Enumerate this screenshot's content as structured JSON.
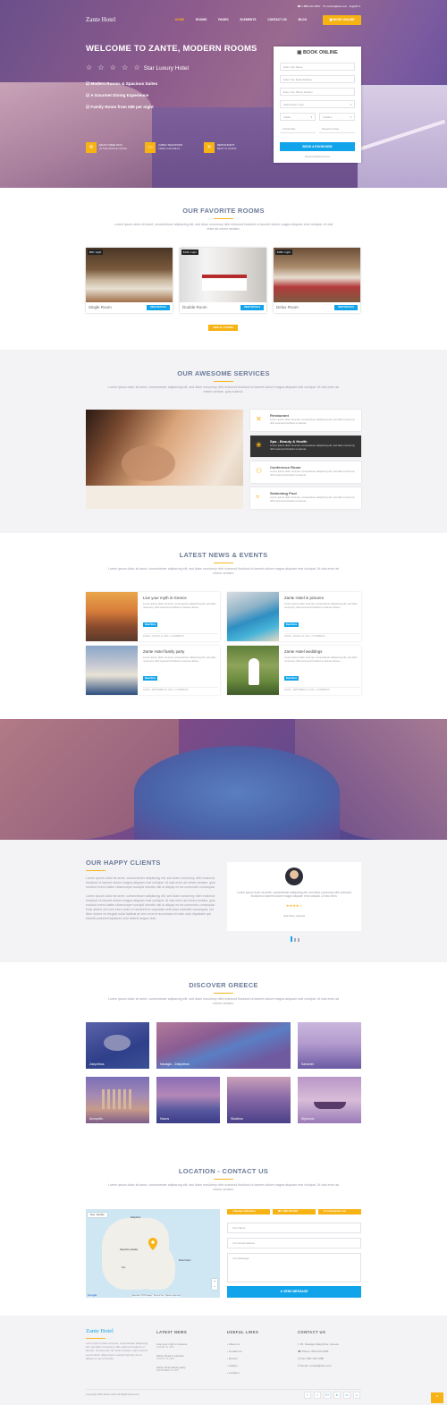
{
  "header": {
    "logo": "Zante Hotel",
    "phone": "1-888-123-4567",
    "email": "contact@site.com",
    "language": "English",
    "menu": [
      "HOME",
      "ROOMS",
      "PAGES",
      "ELEMENTS",
      "CONTACT US",
      "BLOG"
    ],
    "book_button": "BOOK ONLINE"
  },
  "hero": {
    "title": "WELCOME TO ZANTE, MODERN ROOMS",
    "stars": "☆ ☆ ☆ ☆ ☆",
    "rating_label": "Star Luxury Hotel",
    "features": [
      "Modern Rooms & Spacious Suites",
      "A Gourmet Dining Experience",
      "Family Room from €89 per night"
    ],
    "amenities": [
      {
        "icon": "wifi-icon",
        "glyph": "≋",
        "title": "ENJOY FREE WI-FI",
        "sub": "IN THE WHOLE HOTEL"
      },
      {
        "icon": "tv-icon",
        "glyph": "▭",
        "title": "CABLE TELEVISION",
        "sub": "FREE CHANNELS"
      },
      {
        "icon": "restaurant-icon",
        "glyph": "✕",
        "title": "RESTAURANT",
        "sub": "BEST IN ZANTE"
      }
    ]
  },
  "booking": {
    "title": "BOOK ONLINE",
    "name_placeholder": "Enter Your Name",
    "email_placeholder": "Enter Your Email Address",
    "phone_placeholder": "Enter Your Phone Number",
    "room_type": "Select Room Type",
    "adults": "Adults",
    "children": "Children",
    "arrival": "Arrival Date",
    "departure": "Departure Date",
    "submit": "BOOK A ROOM NOW",
    "advanced": "Advanced Booking Form"
  },
  "rooms": {
    "title": "OUR FAVORITE ROOMS",
    "lead": "Lorem ipsum dolor sit amet, consectetuer adipiscing elit, sed diam nonummy nibh euismod tincidunt ut laoreet dolore magna aliquam erat volutpat. Ut wisi enim ad minim veniam.",
    "items": [
      {
        "name": "Single Room",
        "price": "€89 / night",
        "button": "VIEW DETAILS"
      },
      {
        "name": "Double Room",
        "price": "€129 / night",
        "button": "VIEW DETAILS"
      },
      {
        "name": "Delux Room",
        "price": "€189 / night",
        "button": "VIEW DETAILS"
      }
    ],
    "view_all": "VIEW ALL ROOMS"
  },
  "services": {
    "title": "OUR AWESOME SERVICES",
    "lead": "Lorem ipsum dolor sit amet, consectetuer adipiscing elit, sed diam nonummy nibh euismod tincidunt ut laoreet dolore magna aliquam erat volutpat. Ut wisi enim ad minim veniam, quis nostrud.",
    "items": [
      {
        "title": "Restaurant",
        "desc": "Lorem ipsum dolor sit amet, consectetuer adipiscing elit, sed diam nonummy nibh euismod tincidunt ut laoreet.",
        "icon": "restaurant-icon"
      },
      {
        "title": "Spa - Beauty & Health",
        "desc": "Lorem ipsum dolor sit amet, consectetuer adipiscing elit, sed diam nonummy nibh euismod tincidunt ut laoreet.",
        "icon": "spa-icon"
      },
      {
        "title": "Conference Room",
        "desc": "Lorem ipsum dolor sit amet, consectetuer adipiscing elit, sed diam nonummy nibh euismod tincidunt ut laoreet.",
        "icon": "conference-icon"
      },
      {
        "title": "Swimming Pool",
        "desc": "Lorem ipsum dolor sit amet, consectetuer adipiscing elit, sed diam nonummy nibh euismod tincidunt ut laoreet.",
        "icon": "pool-icon"
      }
    ]
  },
  "news": {
    "title": "LATEST NEWS & EVENTS",
    "lead": "Lorem ipsum dolor sit amet, consectetuer adipiscing elit, sed diam nonummy nibh euismod tincidunt ut laoreet dolore magna aliquam erat volutpat. Ut wisi enim ad minim veniam.",
    "items": [
      {
        "title": "Live your myth in Greece",
        "desc": "Lorem ipsum dolor sit amet, consectetuer adipiscing elit, sed diam nonummy nibh euismod tincidunt ut laoreet dolore...",
        "button": "Read More",
        "author": "ZANTE",
        "date": "AUGUST 11, 2015",
        "comments": "0 COMMENTS"
      },
      {
        "title": "Zante Hotel in pictures",
        "desc": "Lorem ipsum dolor sit amet, consectetuer adipiscing elit, sed diam nonummy nibh euismod tincidunt ut laoreet dolore...",
        "button": "Read More",
        "author": "ZANTE",
        "date": "AUGUST 11, 2015",
        "comments": "0 COMMENTS"
      },
      {
        "title": "Zante Hotel family party",
        "desc": "Lorem ipsum dolor sit amet, consectetuer adipiscing elit, sed diam nonummy nibh euismod tincidunt ut laoreet dolore...",
        "button": "Read More",
        "author": "ZANTE",
        "date": "SEPTEMBER 15, 2015",
        "comments": "0 COMMENTS"
      },
      {
        "title": "Zante Hotel weddings",
        "desc": "Lorem ipsum dolor sit amet, consectetuer adipiscing elit, sed diam nonummy nibh euismod tincidunt ut laoreet dolore...",
        "button": "Read More",
        "author": "ZANTE",
        "date": "SEPTEMBER 15, 2015",
        "comments": "0 COMMENTS"
      }
    ]
  },
  "clients": {
    "title": "OUR HAPPY CLIENTS",
    "p1": "Lorem ipsum dolor sit amet, consectetuer adipiscing elit, sed diam nonummy nibh euismod tincidunt ut laoreet dolore magna aliquam erat volutpat. Ut wisi enim ad minim veniam, quis nostrud exerci tation ullamcorper suscipit lobortis nisl ut aliquip ex ea commodo consequat.",
    "p2": "Lorem ipsum dolor sit amet, consectetuer adipiscing elit, sed diam nonummy nibh euismod tincidunt ut laoreet dolore magna aliquam erat volutpat. Ut wisi enim ad minim veniam, quis nostrud exerci tation ullamcorper suscipit lobortis nisl ut aliquip ex ea commodo consequat. Duis autem vel eum iriure dolor in hendrerit in vulputate velit esse molestie consequat, vel illum dolore eu feugiat nulla facilisis at vero eros et accumsan et iusto odio dignissim qui blandit praesent luptatum zzril delenit augue duis.",
    "quote": "Lorem ipsum dolor sit amet, consectetuer adipiscing elit, sed diam nonummy nibh euismod tincidunt ut laoreet dolore magna aliquam erat volutpat. Ut wisi enim.",
    "stars": "★★★★☆",
    "author": "John Doe, Greece"
  },
  "discover": {
    "title": "DISCOVER GREECE",
    "lead": "Lorem ipsum dolor sit amet, consectetuer adipiscing elit, sed diam nonummy nibh euismod tincidunt ut laoreet dolore magna aliquam erat volutpat. Ut wisi enim ad minim veniam.",
    "places": [
      "Zakynthos",
      "Navagio - Zakynthos",
      "Santorini",
      "Acropolis",
      "Naxos",
      "Skiathos",
      "Mykonos",
      "Lefkada"
    ]
  },
  "contact": {
    "title": "LOCATION - CONTACT US",
    "lead": "Lorem ipsum dolor sit amet, consectetuer adipiscing elit, sed diam nonummy nibh euismod tincidunt ut laoreet dolore magna aliquam erat volutpat. Ut wisi enim ad minim veniam.",
    "map_tabs": [
      "Map",
      "Satellite"
    ],
    "map_labels": [
      "Zakynthos",
      "Zakynthos Lithakia",
      "Keri",
      "Mount Kalon"
    ],
    "map_footer": "Map data ©2015 Google · Terms of Use · Report a map error",
    "address": "Navagio Zakynthos",
    "phone": "1-888-123-4567",
    "email": "contact@site.com",
    "name_placeholder": "Your Name",
    "email_placeholder": "Your Email Address",
    "message_placeholder": "Your Message",
    "send": "SEND MESSAGE"
  },
  "footer": {
    "logo": "Zante Hotel",
    "about": "Lorem ipsum dolor sit amet, consectetuer adipiscing elit, sed diam nonummy nibh euismod tincidunt ut laoreet. Ut wisi enim ad minim veniam, quis nostrud exerci tation ullamcorper suscipit lobortis nisl ut aliquip ex ea commodo.",
    "news_title": "LATEST NEWS",
    "news": [
      "Live your myth in Greece",
      "Zante Hotel in pictures",
      "Zante Hotel family party"
    ],
    "news_dates": [
      "AUGUST 11, 2015",
      "AUGUST 11, 2015",
      "SEPTEMBER 15, 2015"
    ],
    "links_title": "USEFUL LINKS",
    "links": [
      "About us",
      "Contact us",
      "Rooms",
      "Gallery",
      "Location"
    ],
    "contact_title": "CONTACT US",
    "contact": [
      "25, Navagio Zakynthos, Greece",
      "Phone: 800 123 3456",
      "Fax: 800 123 3456",
      "Email: contact@site.com"
    ],
    "copyright": "Copyright 2016 Zante Hotel All Rights Reserved",
    "social": [
      "f",
      "t",
      "G+",
      "in",
      "✉",
      "◎"
    ]
  },
  "colors": {
    "accent": "#f7b214",
    "blue": "#12a4ea",
    "heading": "#6c7a99"
  }
}
